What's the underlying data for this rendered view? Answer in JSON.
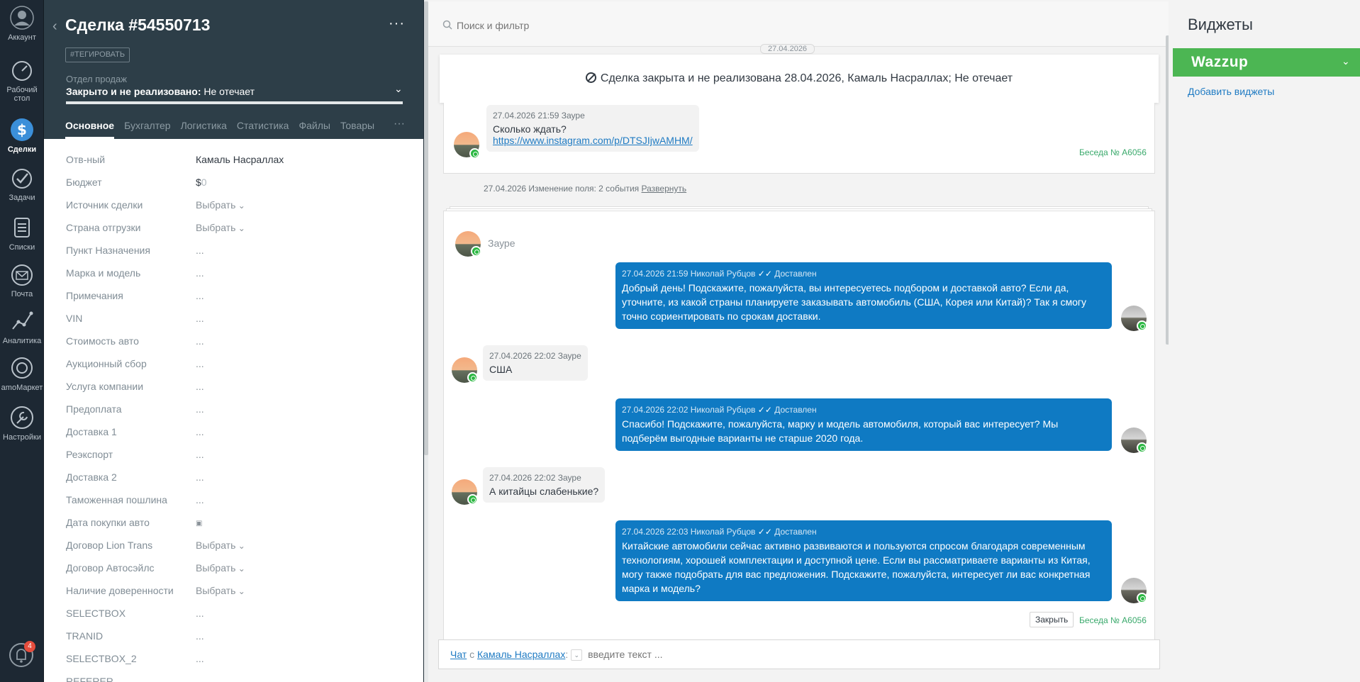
{
  "nav": {
    "items": [
      {
        "label": "Аккаунт"
      },
      {
        "label": "Рабочий стол"
      },
      {
        "label": "Сделки"
      },
      {
        "label": "Задачи"
      },
      {
        "label": "Списки"
      },
      {
        "label": "Почта"
      },
      {
        "label": "Аналитика"
      },
      {
        "label": "amoМаркет"
      },
      {
        "label": "Настройки"
      }
    ],
    "notifications_count": "4"
  },
  "deal": {
    "title": "Сделка #54550713",
    "menu": "···",
    "tag_button": "#ТЕГИРОВАТЬ",
    "pipeline": "Отдел продаж",
    "status_bold": "Закрыто и не реализовано:",
    "status_reason": "Не отечает",
    "tabs": [
      "Основное",
      "Бухгалтер",
      "Логистика",
      "Статистика",
      "Файлы",
      "Товары"
    ],
    "tab_more": "···",
    "fields": [
      {
        "label": "Отв-ный",
        "value": "Камаль Насраллах"
      },
      {
        "label": "Бюджет",
        "currency": "$",
        "value": "0"
      },
      {
        "label": "Источник сделки",
        "value": "Выбрать"
      },
      {
        "label": "Страна отгрузки",
        "value": "Выбрать"
      },
      {
        "label": "Пункт Назначения",
        "value": "..."
      },
      {
        "label": "Марка и модель",
        "value": "..."
      },
      {
        "label": "Примечания",
        "value": "..."
      },
      {
        "label": "VIN",
        "value": "..."
      },
      {
        "label": "Стоимость авто",
        "value": "..."
      },
      {
        "label": "Аукционный сбор",
        "value": "..."
      },
      {
        "label": "Услуга компании",
        "value": "..."
      },
      {
        "label": "Предоплата",
        "value": "..."
      },
      {
        "label": "Доставка 1",
        "value": "..."
      },
      {
        "label": "Реэкспорт",
        "value": "..."
      },
      {
        "label": "Доставка 2",
        "value": "..."
      },
      {
        "label": "Таможенная пошлина",
        "value": "..."
      },
      {
        "label": "Дата покупки авто",
        "value": ""
      },
      {
        "label": "Договор Lion Trans",
        "value": "Выбрать"
      },
      {
        "label": "Договор Автосэйлс",
        "value": "Выбрать"
      },
      {
        "label": "Наличие доверенности",
        "value": "Выбрать"
      },
      {
        "label": "SELECTBOX",
        "value": "..."
      },
      {
        "label": "TRANID",
        "value": "..."
      },
      {
        "label": "SELECTBOX_2",
        "value": "..."
      },
      {
        "label": "REFERER",
        "value": ""
      }
    ]
  },
  "feed": {
    "search_placeholder": "Поиск и фильтр",
    "date_pill": "27.04.2026",
    "closed_banner": "Сделка закрыта и не реализована 28.04.2026, Камаль Насраллах; Не отечает",
    "card1": {
      "meta": "27.04.2026 21:59 Зауре",
      "text": "Сколько ждать?",
      "link": "https://www.instagram.com/p/DTSJIjwAMHM/",
      "conversation": "Беседа № A6056"
    },
    "field_change": {
      "text": "27.04.2026 Изменение поля: 2 события",
      "link": "Развернуть"
    },
    "sender_name": "Зауре",
    "messages": [
      {
        "meta": "27.04.2026 21:59 Николай Рубцов",
        "status": "Доставлен",
        "text": "Добрый день! Подскажите, пожалуйста, вы интересуетесь подбором и доставкой авто? Если да, уточните, из какой страны планируете заказывать автомобиль (США, Корея или Китай)? Так я смогу точно сориентировать по срокам доставки."
      },
      {
        "meta": "27.04.2026 22:02 Зауре",
        "text": "США"
      },
      {
        "meta": "27.04.2026 22:02 Николай Рубцов",
        "status": "Доставлен",
        "text": "Спасибо! Подскажите, пожалуйста, марку и модель автомобиля, который вас интересует? Мы подберём выгодные варианты не старше 2020 года."
      },
      {
        "meta": "27.04.2026 22:02 Зауре",
        "text": "А китайцы слабенькие?"
      },
      {
        "meta": "27.04.2026 22:03 Николай Рубцов",
        "status": "Доставлен",
        "text": "Китайские автомобили сейчас активно развиваются и пользуются спросом благодаря современным технологиям, хорошей комплектации и доступной цене. Если вы рассматриваете варианты из Китая, могу также подобрать для вас предложения. Подскажите, пожалуйста, интересует ли вас конкретная марка и модель?"
      }
    ],
    "close_button": "Закрыть",
    "conversation2": "Беседа № A6056",
    "composer": {
      "chat_label": "Чат",
      "with_text": "с",
      "recipient": "Камаль Насраллах",
      "placeholder": "введите текст ..."
    }
  },
  "widgets": {
    "title": "Виджеты",
    "wazzup": "Wazzup",
    "add_link": "Добавить виджеты"
  },
  "colors": {
    "nav_bg": "#1d2833",
    "deal_head_bg": "#2d3e48",
    "outgoing_bubble": "#0f7ac3",
    "whatsapp_green": "#2bb742",
    "wazzup_green": "#4cb653",
    "link_blue": "#1f7bc3"
  }
}
